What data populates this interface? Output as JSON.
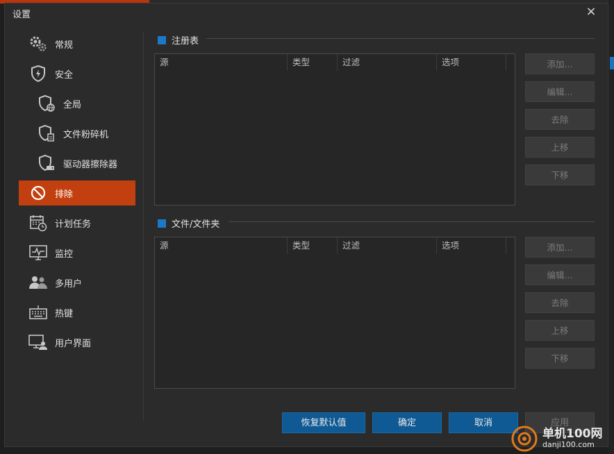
{
  "dialog": {
    "title": "设置",
    "close_glyph": "×"
  },
  "sidebar": {
    "items": [
      {
        "label": "常规",
        "icon": "gears-icon"
      },
      {
        "label": "安全",
        "icon": "shield-lightning-icon"
      },
      {
        "label": "全局",
        "icon": "shield-globe-icon"
      },
      {
        "label": "文件粉碎机",
        "icon": "shield-file-icon"
      },
      {
        "label": "驱动器擦除器",
        "icon": "shield-drive-icon"
      },
      {
        "label": "排除",
        "icon": "ban-icon"
      },
      {
        "label": "计划任务",
        "icon": "calendar-clock-icon"
      },
      {
        "label": "监控",
        "icon": "monitor-icon"
      },
      {
        "label": "多用户",
        "icon": "users-icon"
      },
      {
        "label": "热键",
        "icon": "keyboard-icon"
      },
      {
        "label": "用户界面",
        "icon": "display-user-icon"
      }
    ],
    "active_index": 5
  },
  "registry": {
    "heading": "注册表",
    "columns": [
      "源",
      "类型",
      "过滤",
      "选项"
    ],
    "buttons": [
      "添加...",
      "编辑...",
      "去除",
      "上移",
      "下移"
    ]
  },
  "files": {
    "heading": "文件/文件夹",
    "columns": [
      "源",
      "类型",
      "过滤",
      "选项"
    ],
    "buttons": [
      "添加...",
      "编辑...",
      "去除",
      "上移",
      "下移"
    ]
  },
  "footer": {
    "restore": "恢复默认值",
    "ok": "确定",
    "cancel": "取消",
    "apply": "应用"
  },
  "watermark": {
    "line1": "单机100网",
    "line2": "danji100.com"
  },
  "colors": {
    "accent": "#c2400f",
    "primary_button": "#0f5a94",
    "section_marker": "#1e78c8"
  }
}
